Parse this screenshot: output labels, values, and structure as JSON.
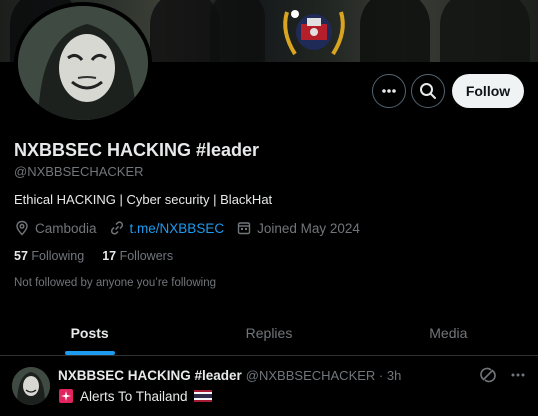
{
  "profile": {
    "display_name": "NXBBSEC HACKING #leader",
    "handle": "@NXBBSECHACKER",
    "bio": "Ethical HACKING | Cyber security | BlackHat",
    "location": "Cambodia",
    "website": "t.me/NXBBSEC",
    "joined": "Joined May 2024",
    "following_count": "57",
    "following_label": "Following",
    "followers_count": "17",
    "followers_label": "Followers",
    "not_followed_text": "Not followed by anyone you’re following"
  },
  "actions": {
    "follow_label": "Follow",
    "more_icon": "more-icon",
    "search_icon": "search-icon"
  },
  "tabs": [
    {
      "label": "Posts",
      "active": true
    },
    {
      "label": "Replies",
      "active": false
    },
    {
      "label": "Media",
      "active": false
    }
  ],
  "tweet": {
    "name": "NXBBSEC HACKING #leader",
    "handle_time": "@NXBBSECHACKER · 3h",
    "text": "Alerts To Thailand"
  },
  "colors": {
    "background": "#000000",
    "accent": "#1d9bf0",
    "muted": "#71767b",
    "text": "#e7e9ea"
  }
}
